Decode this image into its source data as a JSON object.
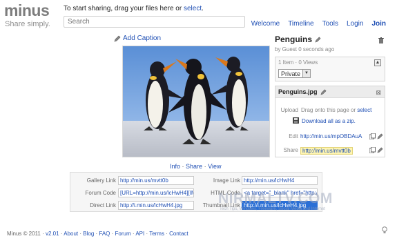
{
  "logo": {
    "text": "minus",
    "tagline": "Share simply."
  },
  "header": {
    "share_prefix": "To start sharing, drag your files here or ",
    "select_link": "select",
    "share_suffix": ".",
    "search_placeholder": "Search"
  },
  "nav": {
    "items": [
      "Welcome",
      "Timeline",
      "Tools",
      "Login",
      "Join"
    ]
  },
  "caption": {
    "label": "Add Caption"
  },
  "photo_actions": {
    "info": "Info",
    "share": "Share",
    "view": "View",
    "sep": "·"
  },
  "gallery": {
    "title": "Penguins",
    "subtitle": "by Guest 0 seconds ago",
    "counts": "1 Item · 0 Views",
    "privacy": "Private"
  },
  "file": {
    "name": "Penguins.jpg",
    "upload_label": "Upload",
    "upload_text": "Drag onto this page or ",
    "upload_select": "select",
    "download": "Download all as a zip.",
    "edit_label": "Edit",
    "edit_url": "http://min.us/mpOBDAuA",
    "share_label": "Share",
    "share_url": "http://min.us/mvtt0b"
  },
  "links": {
    "gallery_label": "Gallery Link",
    "gallery_value": "http://min.us/mvtt0b",
    "forum_label": "Forum Code",
    "forum_value": "[URL=http://min.us/lcHwH4][IMG]",
    "direct_label": "Direct Link",
    "direct_value": "http://i.min.us/lcHwH4.jpg",
    "image_label": "Image Link",
    "image_value": "http://min.us/lcHwH4",
    "html_label": "HTML Code",
    "html_value": "<a target=\"_blank\" href=\"http://",
    "thumb_label": "Thumbnail Link",
    "thumb_value": "http://i.min.us/lcHwH4.jpg"
  },
  "watermark": {
    "text": "NIRMALTV.COM",
    "sub": "Tech Tips, Windows, Freeware, Social Media and Internet"
  },
  "footer": {
    "copyright": "Minus © 2011 · ",
    "version": "v2.01",
    "links": [
      "About",
      "Blog",
      "FAQ",
      "Forum",
      "API",
      "Terms",
      "Contact"
    ],
    "sep": " · "
  },
  "colors": {
    "link": "#1f4fb4",
    "logo": "#7d7d7d",
    "selection": "#2a6fd6",
    "highlight": "#fff5b0"
  }
}
